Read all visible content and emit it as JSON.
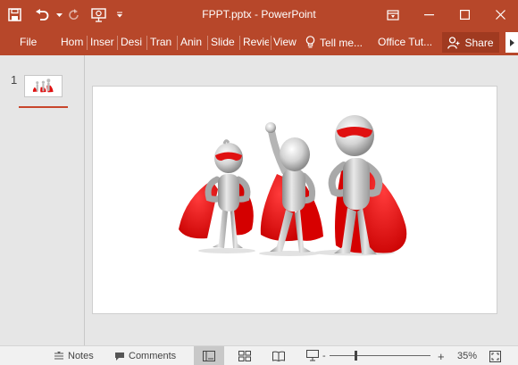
{
  "window": {
    "title": "FPPT.pptx - PowerPoint"
  },
  "ribbon": {
    "file_label": "File",
    "tabs": [
      "Hom",
      "Inser",
      "Desi",
      "Tran",
      "Anin",
      "Slide",
      "Revie",
      "View"
    ],
    "tell_me_label": "Tell me...",
    "office_tut_label": "Office Tut...",
    "share_label": "Share"
  },
  "thumbnails": {
    "slide_number": "1"
  },
  "slide": {
    "image": "three-superheroes-3d-figures"
  },
  "statusbar": {
    "notes_label": "Notes",
    "comments_label": "Comments",
    "zoom_level": "35%",
    "zoom_minus": "-",
    "zoom_plus": "+"
  },
  "colors": {
    "accent": "#b7472a",
    "cape_red": "#e01010"
  },
  "icons": [
    "save-icon",
    "undo-icon",
    "redo-icon",
    "present-icon",
    "customize-icon",
    "restore-icon",
    "minimize-icon",
    "maximize-icon",
    "close-icon",
    "lightbulb-icon",
    "person-icon",
    "notes-icon",
    "comments-icon",
    "normal-view-icon",
    "sorter-view-icon",
    "reading-view-icon",
    "slideshow-icon",
    "fit-slide-icon"
  ]
}
